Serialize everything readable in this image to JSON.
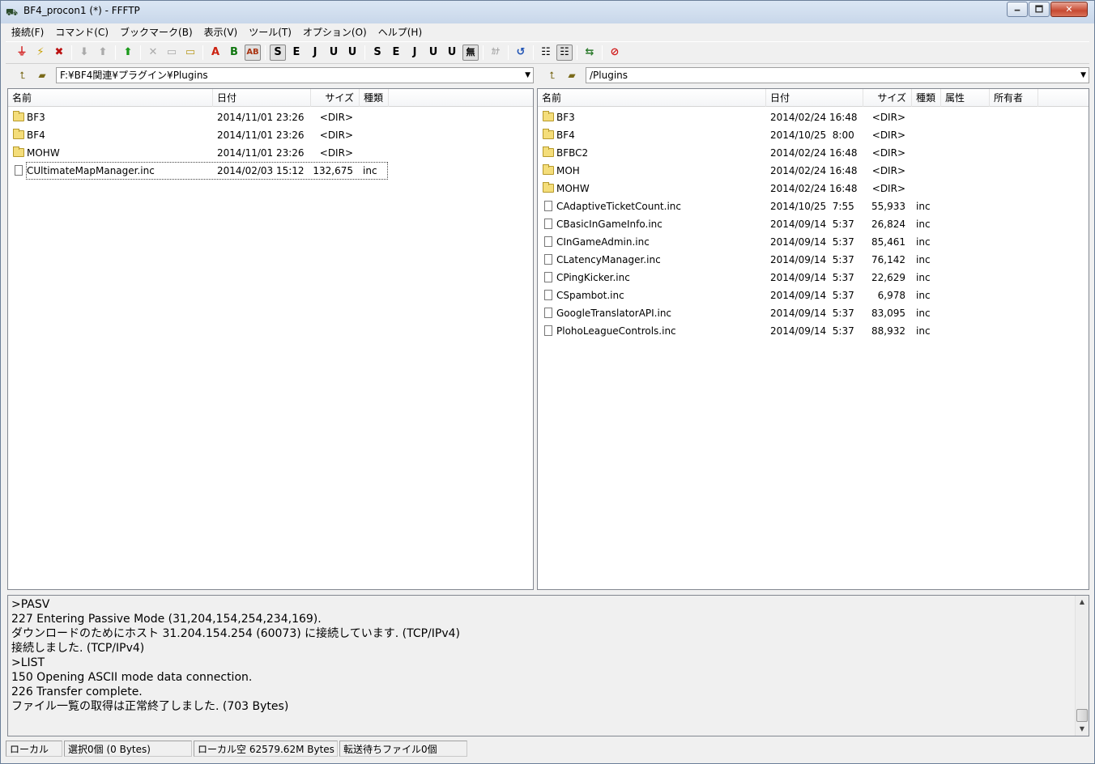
{
  "window": {
    "title": "BF4_procon1 (*) - FFFTP",
    "minimize": "🗕",
    "maximize": "🗖",
    "close": "✕"
  },
  "menu": [
    "接続(F)",
    "コマンド(C)",
    "ブックマーク(B)",
    "表示(V)",
    "ツール(T)",
    "オプション(O)",
    "ヘルプ(H)"
  ],
  "toolbar": {
    "connect": "⏚",
    "quick_connect": "⚡",
    "disconnect": "✖",
    "download": "⬇",
    "upload": "⬆",
    "mirror_upload": "⬆",
    "delete": "✕",
    "rename": "▭",
    "mkdir": "▭",
    "mode_ascii": "A",
    "mode_binary": "B",
    "mode_auto": "AB",
    "kanji_sjis_host": "S",
    "kanji_euc_host": "E",
    "kanji_jis_host": "J",
    "kanji_utf8_host": "U",
    "kanji_utf8bom_host": "U",
    "kanji_sjis_local": "S",
    "kanji_euc_local": "E",
    "kanji_jis_local": "J",
    "kanji_utf8_local": "U",
    "kanji_utf8bom_local": "U",
    "kanji_none": "無",
    "kana": "ｶﾅ",
    "refresh": "↺",
    "list_view": "☷",
    "detail_view": "☷",
    "sync_dirs": "⇆",
    "stop": "⊘"
  },
  "local_path": {
    "value": "F:¥BF4関連¥プラグイン¥Plugins",
    "dropdown": "▼"
  },
  "remote_path": {
    "value": "/Plugins",
    "dropdown": "▼"
  },
  "local_headers": [
    "名前",
    "日付",
    "サイズ",
    "種類"
  ],
  "remote_headers": [
    "名前",
    "日付",
    "サイズ",
    "種類",
    "属性",
    "所有者"
  ],
  "local_files": [
    {
      "name": "BF3",
      "date": "2014/11/01 23:26",
      "size": "<DIR>",
      "type": "",
      "icon": "folder-icon"
    },
    {
      "name": "BF4",
      "date": "2014/11/01 23:26",
      "size": "<DIR>",
      "type": "",
      "icon": "folder-icon"
    },
    {
      "name": "MOHW",
      "date": "2014/11/01 23:26",
      "size": "<DIR>",
      "type": "",
      "icon": "folder-icon"
    },
    {
      "name": "CUltimateMapManager.inc",
      "date": "2014/02/03 15:12",
      "size": "132,675",
      "type": "inc",
      "icon": "file-icon"
    }
  ],
  "remote_files": [
    {
      "name": "BF3",
      "date": "2014/02/24 16:48",
      "size": "<DIR>",
      "type": "",
      "icon": "folder-icon"
    },
    {
      "name": "BF4",
      "date": "2014/10/25  8:00",
      "size": "<DIR>",
      "type": "",
      "icon": "folder-icon"
    },
    {
      "name": "BFBC2",
      "date": "2014/02/24 16:48",
      "size": "<DIR>",
      "type": "",
      "icon": "folder-icon"
    },
    {
      "name": "MOH",
      "date": "2014/02/24 16:48",
      "size": "<DIR>",
      "type": "",
      "icon": "folder-icon"
    },
    {
      "name": "MOHW",
      "date": "2014/02/24 16:48",
      "size": "<DIR>",
      "type": "",
      "icon": "folder-icon"
    },
    {
      "name": "CAdaptiveTicketCount.inc",
      "date": "2014/10/25  7:55",
      "size": "55,933",
      "type": "inc",
      "icon": "file-icon"
    },
    {
      "name": "CBasicInGameInfo.inc",
      "date": "2014/09/14  5:37",
      "size": "26,824",
      "type": "inc",
      "icon": "file-icon"
    },
    {
      "name": "CInGameAdmin.inc",
      "date": "2014/09/14  5:37",
      "size": "85,461",
      "type": "inc",
      "icon": "file-icon"
    },
    {
      "name": "CLatencyManager.inc",
      "date": "2014/09/14  5:37",
      "size": "76,142",
      "type": "inc",
      "icon": "file-icon"
    },
    {
      "name": "CPingKicker.inc",
      "date": "2014/09/14  5:37",
      "size": "22,629",
      "type": "inc",
      "icon": "file-icon"
    },
    {
      "name": "CSpambot.inc",
      "date": "2014/09/14  5:37",
      "size": "6,978",
      "type": "inc",
      "icon": "file-icon"
    },
    {
      "name": "GoogleTranslatorAPI.inc",
      "date": "2014/09/14  5:37",
      "size": "83,095",
      "type": "inc",
      "icon": "file-icon"
    },
    {
      "name": "PlohoLeagueControls.inc",
      "date": "2014/09/14  5:37",
      "size": "88,932",
      "type": "inc",
      "icon": "file-icon"
    }
  ],
  "log": [
    ">PASV",
    "227 Entering Passive Mode (31,204,154,254,234,169).",
    "ダウンロードのためにホスト 31.204.154.254 (60073) に接続しています. (TCP/IPv4)",
    "接続しました. (TCP/IPv4)",
    ">LIST",
    "150 Opening ASCII mode data connection.",
    "226 Transfer complete.",
    "ファイル一覧の取得は正常終了しました. (703 Bytes)"
  ],
  "status": {
    "location": "ローカル",
    "selection": "選択0個 (0 Bytes)",
    "free_space": "ローカル空 62579.62M Bytes",
    "queue": "転送待ちファイル0個"
  },
  "colors": {
    "accent": "#2a62c7",
    "close_button": "#c74a32"
  }
}
